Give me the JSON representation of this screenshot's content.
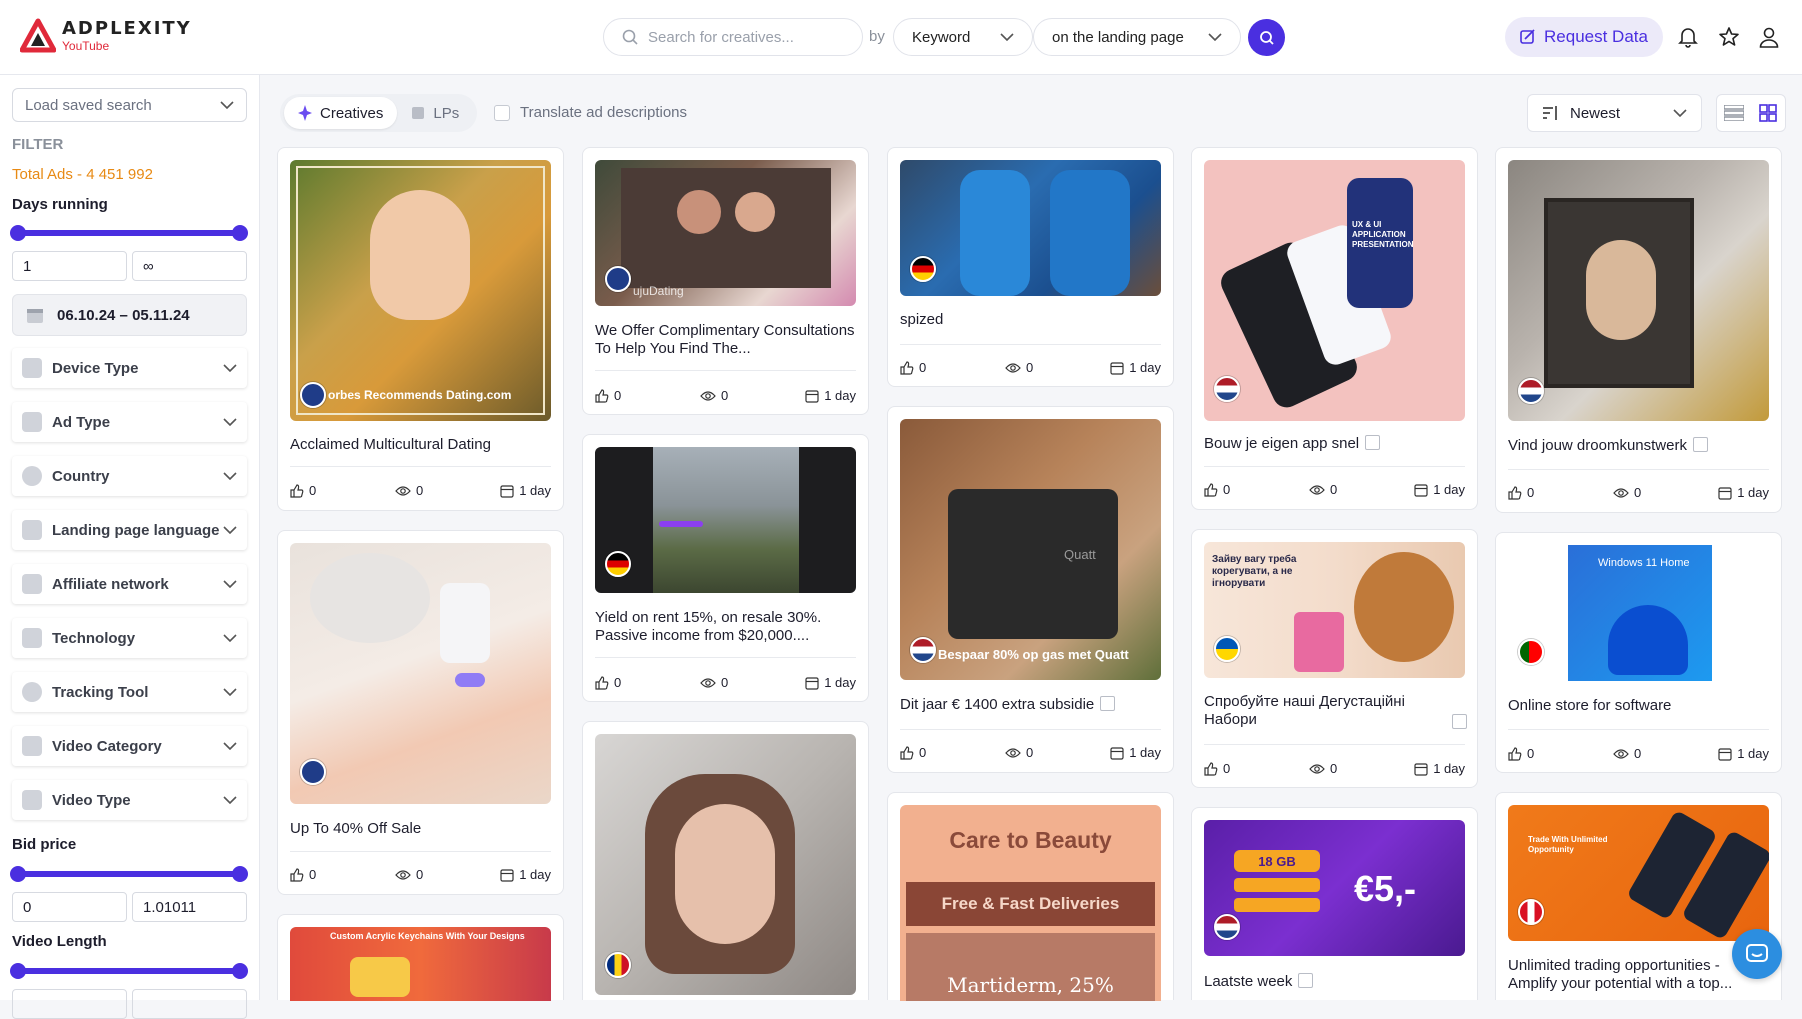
{
  "app": {
    "name": "ADPLEXITY",
    "sub": "YouTube"
  },
  "header": {
    "search_placeholder": "Search for creatives...",
    "by_label": "by",
    "search_by": "Keyword",
    "search_where": "on the landing page",
    "request_label": "Request Data"
  },
  "sidebar": {
    "saved_search": "Load saved search",
    "filter_label": "FILTER",
    "total_ads": "Total Ads - 4 451 992",
    "days_running": {
      "label": "Days running",
      "min": "1",
      "max": "∞"
    },
    "date_range": "06.10.24 – 05.11.24",
    "filters": [
      "Device Type",
      "Ad Type",
      "Country",
      "Landing page language",
      "Affiliate network",
      "Technology",
      "Tracking Tool",
      "Video Category",
      "Video Type"
    ],
    "bid_price": {
      "label": "Bid price",
      "min": "0",
      "max": "1.01011"
    },
    "video_length": {
      "label": "Video Length"
    }
  },
  "toolbar": {
    "tab_creatives": "Creatives",
    "tab_lps": "LPs",
    "translate_label": "Translate ad descriptions",
    "sort": "Newest"
  },
  "cards": [
    {
      "title": "Acclaimed Multicultural Dating",
      "caption": "orbes Recommends Dating.com",
      "likes": "0",
      "views": "0",
      "age": "1 day",
      "flag": "gb"
    },
    {
      "title": "We Offer Complimentary Consultations To Help You Find The...",
      "caption": "ujuDating",
      "likes": "0",
      "views": "0",
      "age": "1 day",
      "flag": "gb"
    },
    {
      "title": "spized",
      "likes": "0",
      "views": "0",
      "age": "1 day",
      "flag": "de"
    },
    {
      "title": "Bouw je eigen app snel",
      "likes": "0",
      "views": "0",
      "age": "1 day",
      "flag": "nl",
      "thumb_text": "UX & UI APPLICATION PRESENTATION"
    },
    {
      "title": "Vind jouw droomkunstwerk",
      "likes": "0",
      "views": "0",
      "age": "1 day",
      "flag": "nl"
    },
    {
      "title": "Up To 40% Off Sale",
      "likes": "0",
      "views": "0",
      "age": "1 day",
      "flag": "gb"
    },
    {
      "title": "Yield on rent 15%, on resale 30%. Passive income from $20,000....",
      "likes": "0",
      "views": "0",
      "age": "1 day",
      "flag": "de"
    },
    {
      "title": "Dit jaar € 1400 extra subsidie",
      "caption": "Bespaar 80% op gas met Quatt",
      "likes": "0",
      "views": "0",
      "age": "1 day",
      "flag": "nl",
      "thumb_text": "Quatt"
    },
    {
      "title": "Спробуйте наші Дегустаційні Набори",
      "likes": "0",
      "views": "0",
      "age": "1 day",
      "flag": "ua",
      "thumb_text": "Зайву вагу треба корегувати, а не ігнорувати"
    },
    {
      "title": "Online store for software",
      "likes": "0",
      "views": "0",
      "age": "1 day",
      "flag": "pt",
      "thumb_text": "Windows 11 Home"
    },
    {
      "flag": "gb",
      "thumb_text": "Custom Acrylic Keychains With Your Designs"
    },
    {
      "flag": "ro"
    },
    {
      "thumb_title": "Care to Beauty",
      "thumb_banner": "Free & Fast Deliveries",
      "thumb_bottom": "Martiderm, 25%"
    },
    {
      "title": "Laatste week",
      "flag": "nl",
      "thumb_text": "18 GB",
      "thumb_price": "€5,-"
    },
    {
      "title": "Unlimited trading opportunities - Amplify your potential with a top...",
      "flag": "pe",
      "thumb_text": "Trade With Unlimited Opportunity"
    }
  ]
}
